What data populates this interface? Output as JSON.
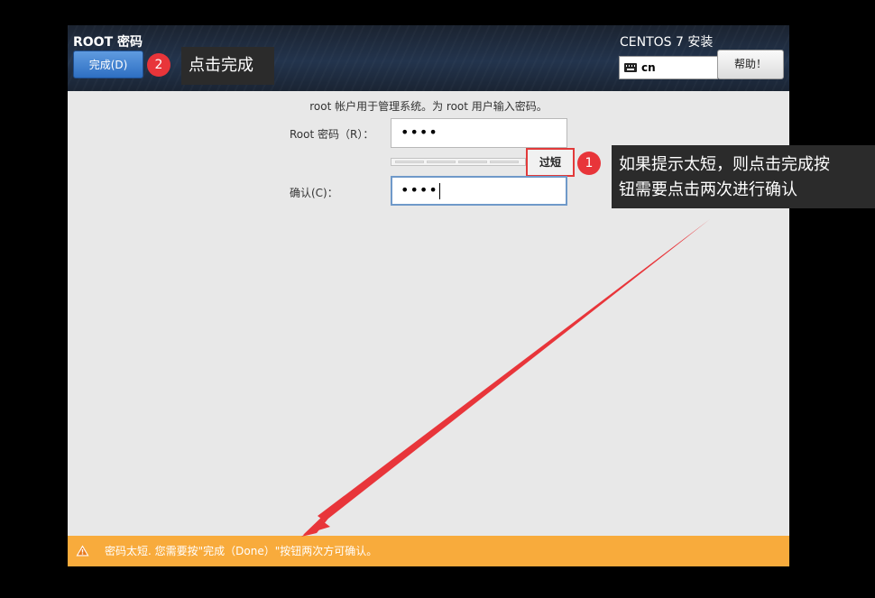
{
  "header": {
    "page_title": "ROOT 密码",
    "done_label": "完成(D)",
    "product_title": "CENTOS 7 安装",
    "keyboard_layout": "cn",
    "help_label": "帮助！"
  },
  "form": {
    "description": "root 帐户用于管理系统。为 root 用户输入密码。",
    "root_password_label": "Root 密码（R）：",
    "root_password_value": "••••",
    "confirm_label": "确认(C)：",
    "confirm_value": "••••",
    "strength_label": "过短"
  },
  "warning": {
    "text": "密码太短. 您需要按\"完成（Done）\"按钮两次方可确认。",
    "icon": "warning-icon",
    "color": "#f8ab3c"
  },
  "annotations": {
    "badge1": "1",
    "tip1": "如果提示太短，则点击完成按钮需要点击两次进行确认",
    "tip1_line1": "如果提示太短，则点击完成按",
    "tip1_line2": "钮需要点击两次进行确认",
    "badge2": "2",
    "tip2": "点击完成",
    "highlight_color": "#e23a3a"
  }
}
